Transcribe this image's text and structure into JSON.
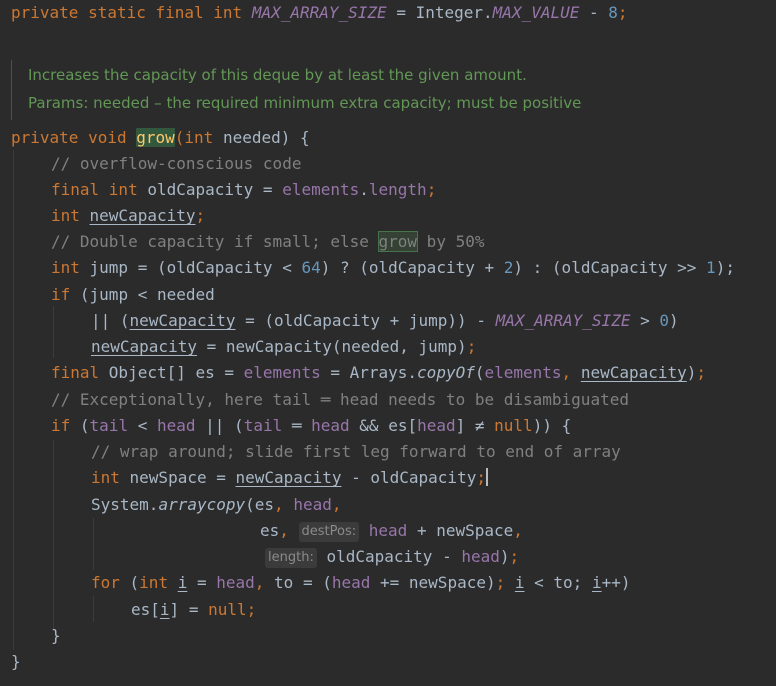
{
  "colors": {
    "background": "#2b2b2b",
    "keyword": "#cc7832",
    "field": "#9876aa",
    "number": "#6897bb",
    "comment": "#808080",
    "doc_comment": "#629755",
    "method_decl": "#ffc66d",
    "default_text": "#a9b7c6",
    "highlight": "#32593d"
  },
  "code": {
    "line0": {
      "t1": "private static final int ",
      "t2": "MAX_ARRAY_SIZE",
      "t3": " = Integer.",
      "t4": "MAX_VALUE",
      "t5": " - ",
      "t6": "8",
      ";": ";"
    },
    "doc1": "Increases the capacity of this deque by at least the given amount.",
    "doc2": "Params: needed – the required minimum extra capacity; must be positive",
    "l1": {
      "t1": "private void ",
      "t2": "grow",
      "t3": "(",
      "t4": "int ",
      "t5": "needed) {"
    },
    "l2": "// overflow-conscious code",
    "l3": {
      "t1": "final int ",
      "t2": "oldCapacity = ",
      "t3": "elements",
      "t4": ".",
      "t5": "length",
      "t6": ";"
    },
    "l4": {
      "t1": "int ",
      "t2": "newCapacity",
      "t3": ";"
    },
    "l5": {
      "t1": "// Double capacity if small; else ",
      "t2": "grow",
      "t3": " by 50%"
    },
    "l6": {
      "t1": "int ",
      "t2": "jump = (oldCapacity < ",
      "t3": "64",
      "t4": ") ? (oldCapacity + ",
      "t5": "2",
      "t6": ") : (oldCapacity >> ",
      "t7": "1",
      "t8": ");"
    },
    "l7": {
      "t1": "if ",
      "t2": "(jump < needed"
    },
    "l8": {
      "t1": "|| (",
      "t2": "newCapacity",
      "t3": " = (oldCapacity + jump)) - ",
      "t4": "MAX_ARRAY_SIZE",
      "t5": " > ",
      "t6": "0",
      "t7": ")"
    },
    "l9": {
      "t1": "newCapacity",
      "t2": " = newCapacity(needed, jump)",
      "t3": ";"
    },
    "l10": {
      "t1": "final ",
      "t2": "Object[] es = ",
      "t3": "elements",
      "t4": " = Arrays.",
      "t5": "copyOf",
      "t6": "(",
      "t7": "elements",
      ",": ", ",
      "t8": "newCapacity",
      "t9": ")",
      ";": ";"
    },
    "l11": "// Exceptionally, here tail ═ head needs to be disambiguated",
    "l12": {
      "t1": "if ",
      "t2": "(",
      "t3": "tail",
      " lt": " < ",
      "t4": "head",
      " or": " || (",
      "t5": "tail",
      " eq": " ═ ",
      "t6": "head",
      " and": " && es[",
      "t7": "head",
      "t8": "] ≠ ",
      "t9": "null",
      "t10": ")) {"
    },
    "l13": "// wrap around; slide first leg forward to end of array",
    "l14": {
      "t1": "int ",
      "t2": "newSpace = ",
      "t3": "newCapacity",
      "t4": " - oldCapacity",
      "t5": ";"
    },
    "l15": {
      "t1": "System.",
      "t2": "arraycopy",
      "t3": "(es",
      ",": ", ",
      "t4": "head",
      ",2": ","
    },
    "l16": {
      "t1": "es",
      ",": ", ",
      "hint": "destPos:",
      "t2": "head",
      "t3": " + newSpace",
      ",2": ","
    },
    "l17": {
      "hint": "length:",
      "t1": "oldCapacity - ",
      "t2": "head",
      "t3": ")",
      ";": ";"
    },
    "l18": {
      "t1": "for ",
      "t2": "(",
      "t3": "int ",
      "t4": "i",
      " eq": " = ",
      "t5": "head",
      ",": ", ",
      "t6": "to = (",
      "t7": "head",
      "t8": " += newSpace)",
      ";": "; ",
      "t9": "i",
      "t10": " < to; ",
      "t11": "i",
      "t12": "++)"
    },
    "l19": {
      "t1": "es[",
      "t2": "i",
      "t3": "] = ",
      "t4": "null",
      ";": ";"
    },
    "l20": "}",
    "l21": "}"
  }
}
